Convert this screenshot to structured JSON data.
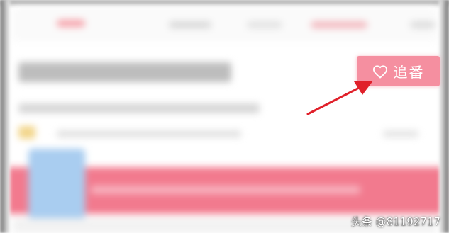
{
  "follow_button": {
    "label": "追番",
    "icon": "heart-outline-icon",
    "color": "#f58fa0"
  },
  "annotation": {
    "arrow_color": "#e0202a"
  },
  "watermark": {
    "text": "头条 @81192717"
  }
}
